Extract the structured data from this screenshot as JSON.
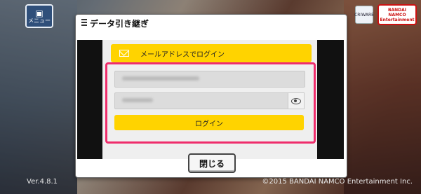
{
  "app": {
    "menu_label": "メニュー",
    "version": "Ver.4.8.1",
    "copyright": "©2015 BANDAI NAMCO Entertainment Inc.",
    "logo_left_text": "CRIWARE",
    "logo_right_text": "BANDAI NAMCO Entertainment"
  },
  "dialog": {
    "title": "データ引き継ぎ",
    "mail_login_label": "メールアドレスでログイン",
    "login_button_label": "ログイン",
    "close_button_label": "閉じる"
  },
  "colors": {
    "highlight_border": "#ef2d6c",
    "button_yellow": "#ffd300"
  },
  "icons": {
    "mail": "mail-icon",
    "eye": "eye-icon",
    "menu": "menu-icon"
  }
}
